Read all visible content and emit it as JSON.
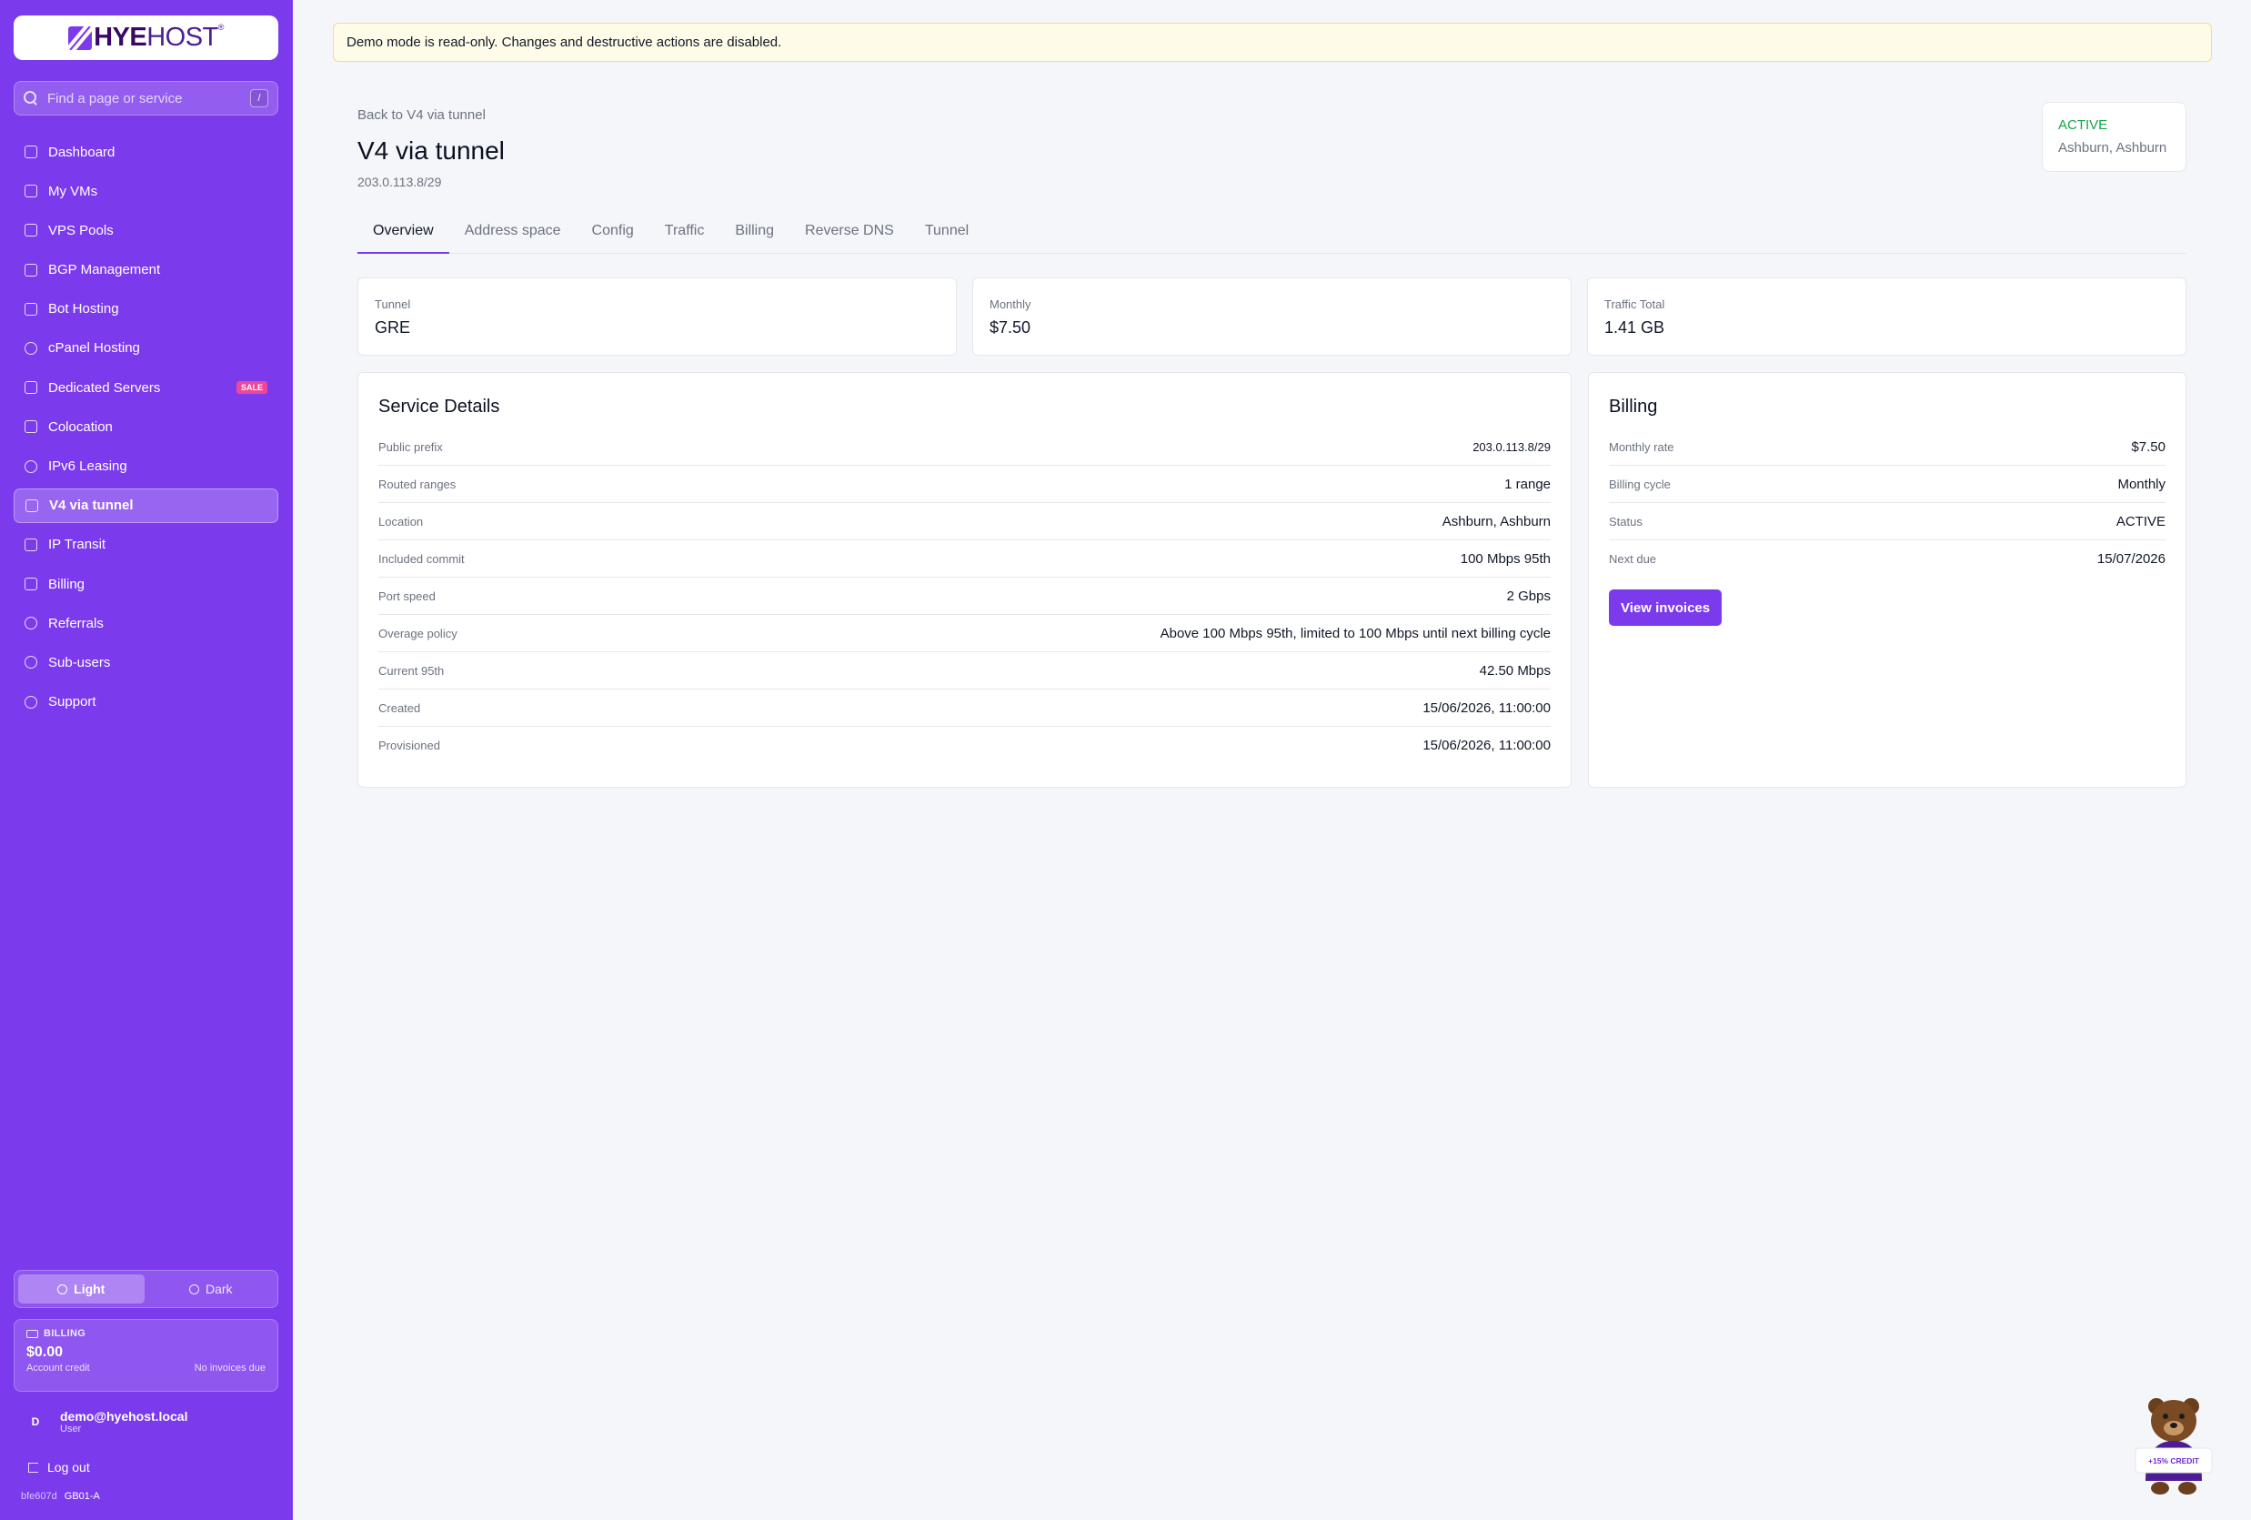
{
  "brand": {
    "name_bold": "HYE",
    "name_rest": "HOST",
    "mark": "®"
  },
  "search": {
    "placeholder": "Find a page or service",
    "shortcut": "/"
  },
  "sidebar": {
    "items": [
      {
        "label": "Dashboard",
        "icon": "grid-icon"
      },
      {
        "label": "My VMs",
        "icon": "server-icon"
      },
      {
        "label": "VPS Pools",
        "icon": "cubes-icon"
      },
      {
        "label": "BGP Management",
        "icon": "broadcast-icon"
      },
      {
        "label": "Bot Hosting",
        "icon": "bot-icon"
      },
      {
        "label": "cPanel Hosting",
        "icon": "globe-icon"
      },
      {
        "label": "Dedicated Servers",
        "icon": "server-icon",
        "badge": "SALE"
      },
      {
        "label": "Colocation",
        "icon": "building-icon"
      },
      {
        "label": "IPv6 Leasing",
        "icon": "globe-icon"
      },
      {
        "label": "V4 via tunnel",
        "icon": "network-icon",
        "active": true
      },
      {
        "label": "IP Transit",
        "icon": "network-icon"
      },
      {
        "label": "Billing",
        "icon": "receipt-icon"
      },
      {
        "label": "Referrals",
        "icon": "gift-icon"
      },
      {
        "label": "Sub-users",
        "icon": "users-icon"
      },
      {
        "label": "Support",
        "icon": "headset-icon"
      }
    ],
    "theme": {
      "light": "Light",
      "dark": "Dark",
      "selected": "Light"
    },
    "billing": {
      "label": "BILLING",
      "amount": "$0.00",
      "sub_left": "Account credit",
      "sub_right": "No invoices due"
    },
    "user": {
      "initial": "D",
      "email": "demo@hyehost.local",
      "role": "User"
    },
    "logout": "Log out",
    "build": {
      "hash": "bfe607d",
      "node": "GB01-A"
    }
  },
  "banner": "Demo mode is read-only. Changes and destructive actions are disabled.",
  "page": {
    "back": "Back to V4 via tunnel",
    "title": "V4 via tunnel",
    "subtitle": "203.0.113.8/29",
    "status": "ACTIVE",
    "location": "Ashburn, Ashburn"
  },
  "tabs": [
    "Overview",
    "Address space",
    "Config",
    "Traffic",
    "Billing",
    "Reverse DNS",
    "Tunnel"
  ],
  "stats": [
    {
      "label": "Tunnel",
      "value": "GRE"
    },
    {
      "label": "Monthly",
      "value": "$7.50"
    },
    {
      "label": "Traffic Total",
      "value": "1.41 GB"
    }
  ],
  "service_details": {
    "title": "Service Details",
    "rows": [
      {
        "k": "Public prefix",
        "v": "203.0.113.8/29"
      },
      {
        "k": "Routed ranges",
        "v": "1 range"
      },
      {
        "k": "Location",
        "v": "Ashburn, Ashburn"
      },
      {
        "k": "Included commit",
        "v": "100 Mbps 95th"
      },
      {
        "k": "Port speed",
        "v": "2 Gbps"
      },
      {
        "k": "Overage policy",
        "v": "Above 100 Mbps 95th, limited to 100 Mbps until next billing cycle"
      },
      {
        "k": "Current 95th",
        "v": "42.50 Mbps"
      },
      {
        "k": "Created",
        "v": "15/06/2026, 11:00:00"
      },
      {
        "k": "Provisioned",
        "v": "15/06/2026, 11:00:00"
      }
    ]
  },
  "billing": {
    "title": "Billing",
    "rows": [
      {
        "k": "Monthly rate",
        "v": "$7.50"
      },
      {
        "k": "Billing cycle",
        "v": "Monthly"
      },
      {
        "k": "Status",
        "v": "ACTIVE"
      },
      {
        "k": "Next due",
        "v": "15/07/2026"
      }
    ],
    "button": "View invoices"
  },
  "mascot": {
    "sign": "+15% CREDIT"
  },
  "colors": {
    "accent": "#7c3aed",
    "active": "#16a34a",
    "banner_bg": "#fefce8"
  }
}
